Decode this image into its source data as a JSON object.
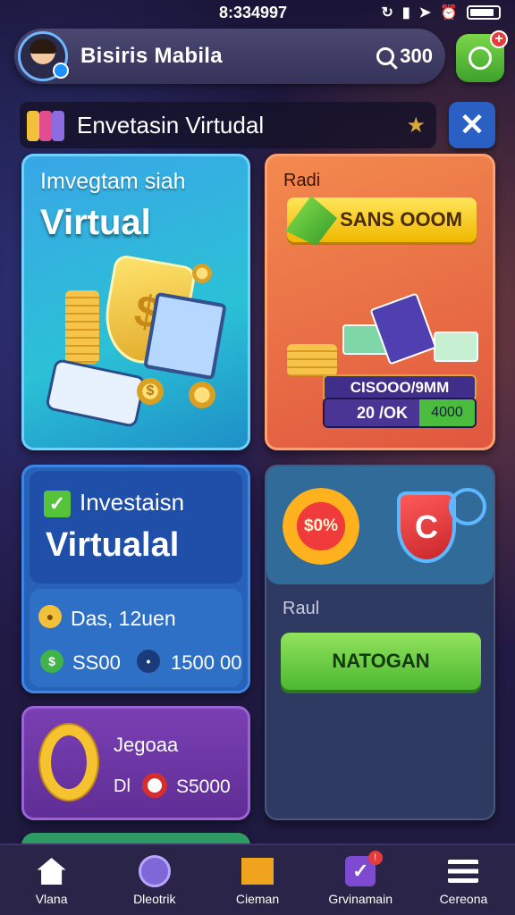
{
  "status": {
    "time": "8:334997"
  },
  "header": {
    "name": "Bisiris Mabila",
    "search_value": "300"
  },
  "title_row": {
    "title": "Envetasin Virtudal"
  },
  "card1": {
    "title": "Imvegtam siah",
    "big": "Virtual",
    "symbol": "$"
  },
  "card2": {
    "title": "Radi",
    "bar_label": "SANS OOOM",
    "panel_top": "CISOOO/9MM",
    "panel_left": "20 /OK",
    "panel_right": "4000"
  },
  "card3": {
    "title": "Investaisn",
    "big": "Virtualal",
    "date": "Das, 12uen",
    "value1": "SS00",
    "value2": "1500 00"
  },
  "card4": {
    "gear_label": "$0%",
    "shield_label": "C",
    "label": "Raul",
    "button": "NATOGAN"
  },
  "card5": {
    "title": "Jegoaa",
    "prefix": "Dl",
    "value": "S5000"
  },
  "nav": {
    "items": [
      {
        "label": "Vlana",
        "icon": "home-icon"
      },
      {
        "label": "Dleotrik",
        "icon": "profile-icon"
      },
      {
        "label": "Cieman",
        "icon": "mail-icon"
      },
      {
        "label": "Grvinamain",
        "icon": "checklist-icon"
      },
      {
        "label": "Cereona",
        "icon": "menu-icon"
      }
    ]
  },
  "colors": {
    "background": "#1a1538",
    "accent_green": "#4db831",
    "accent_blue": "#2a5fc4",
    "card_orange": "#e0573f",
    "card_purple": "#5f2e95"
  }
}
